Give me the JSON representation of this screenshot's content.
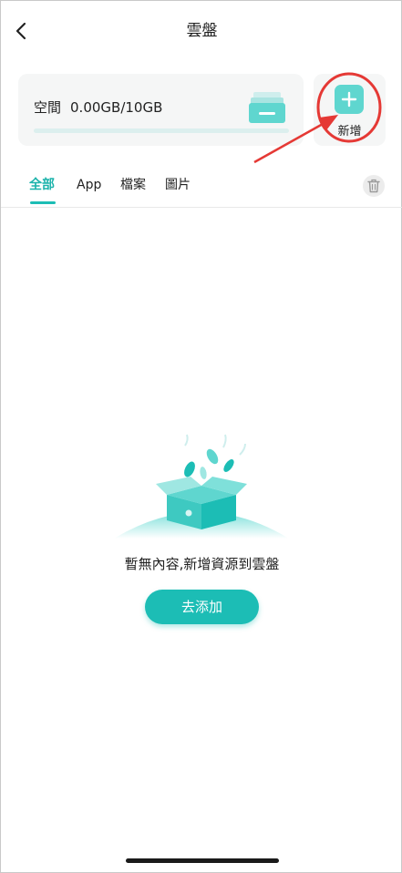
{
  "header": {
    "title": "雲盤"
  },
  "storage": {
    "label": "空間",
    "value": "0.00GB/10GB",
    "used_fraction": 0.0
  },
  "add_button": {
    "label": "新增"
  },
  "tabs": [
    {
      "label": "全部",
      "active": true
    },
    {
      "label": "App",
      "active": false
    },
    {
      "label": "檔案",
      "active": false
    },
    {
      "label": "圖片",
      "active": false
    }
  ],
  "empty_state": {
    "message": "暫無內容,新增資源到雲盤",
    "action_label": "去添加"
  },
  "colors": {
    "accent": "#1cbdb5",
    "accent_light": "#5fd6cf",
    "annotation_red": "#e53935"
  },
  "icons": {
    "back": "chevron-left-icon",
    "add": "plus-icon",
    "trash": "trash-icon",
    "storage": "storage-drive-icon"
  }
}
